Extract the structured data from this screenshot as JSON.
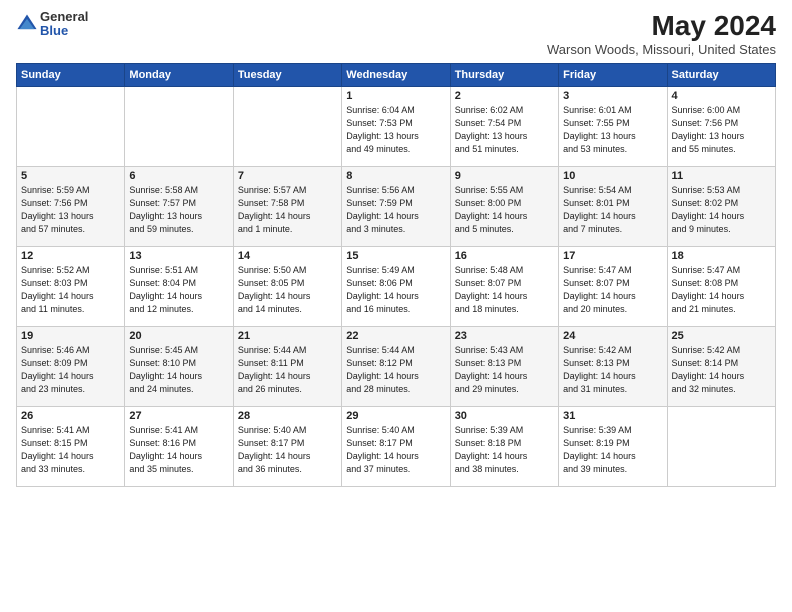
{
  "logo": {
    "general": "General",
    "blue": "Blue"
  },
  "title": "May 2024",
  "subtitle": "Warson Woods, Missouri, United States",
  "headers": [
    "Sunday",
    "Monday",
    "Tuesday",
    "Wednesday",
    "Thursday",
    "Friday",
    "Saturday"
  ],
  "weeks": [
    [
      {
        "day": "",
        "info": ""
      },
      {
        "day": "",
        "info": ""
      },
      {
        "day": "",
        "info": ""
      },
      {
        "day": "1",
        "info": "Sunrise: 6:04 AM\nSunset: 7:53 PM\nDaylight: 13 hours\nand 49 minutes."
      },
      {
        "day": "2",
        "info": "Sunrise: 6:02 AM\nSunset: 7:54 PM\nDaylight: 13 hours\nand 51 minutes."
      },
      {
        "day": "3",
        "info": "Sunrise: 6:01 AM\nSunset: 7:55 PM\nDaylight: 13 hours\nand 53 minutes."
      },
      {
        "day": "4",
        "info": "Sunrise: 6:00 AM\nSunset: 7:56 PM\nDaylight: 13 hours\nand 55 minutes."
      }
    ],
    [
      {
        "day": "5",
        "info": "Sunrise: 5:59 AM\nSunset: 7:56 PM\nDaylight: 13 hours\nand 57 minutes."
      },
      {
        "day": "6",
        "info": "Sunrise: 5:58 AM\nSunset: 7:57 PM\nDaylight: 13 hours\nand 59 minutes."
      },
      {
        "day": "7",
        "info": "Sunrise: 5:57 AM\nSunset: 7:58 PM\nDaylight: 14 hours\nand 1 minute."
      },
      {
        "day": "8",
        "info": "Sunrise: 5:56 AM\nSunset: 7:59 PM\nDaylight: 14 hours\nand 3 minutes."
      },
      {
        "day": "9",
        "info": "Sunrise: 5:55 AM\nSunset: 8:00 PM\nDaylight: 14 hours\nand 5 minutes."
      },
      {
        "day": "10",
        "info": "Sunrise: 5:54 AM\nSunset: 8:01 PM\nDaylight: 14 hours\nand 7 minutes."
      },
      {
        "day": "11",
        "info": "Sunrise: 5:53 AM\nSunset: 8:02 PM\nDaylight: 14 hours\nand 9 minutes."
      }
    ],
    [
      {
        "day": "12",
        "info": "Sunrise: 5:52 AM\nSunset: 8:03 PM\nDaylight: 14 hours\nand 11 minutes."
      },
      {
        "day": "13",
        "info": "Sunrise: 5:51 AM\nSunset: 8:04 PM\nDaylight: 14 hours\nand 12 minutes."
      },
      {
        "day": "14",
        "info": "Sunrise: 5:50 AM\nSunset: 8:05 PM\nDaylight: 14 hours\nand 14 minutes."
      },
      {
        "day": "15",
        "info": "Sunrise: 5:49 AM\nSunset: 8:06 PM\nDaylight: 14 hours\nand 16 minutes."
      },
      {
        "day": "16",
        "info": "Sunrise: 5:48 AM\nSunset: 8:07 PM\nDaylight: 14 hours\nand 18 minutes."
      },
      {
        "day": "17",
        "info": "Sunrise: 5:47 AM\nSunset: 8:07 PM\nDaylight: 14 hours\nand 20 minutes."
      },
      {
        "day": "18",
        "info": "Sunrise: 5:47 AM\nSunset: 8:08 PM\nDaylight: 14 hours\nand 21 minutes."
      }
    ],
    [
      {
        "day": "19",
        "info": "Sunrise: 5:46 AM\nSunset: 8:09 PM\nDaylight: 14 hours\nand 23 minutes."
      },
      {
        "day": "20",
        "info": "Sunrise: 5:45 AM\nSunset: 8:10 PM\nDaylight: 14 hours\nand 24 minutes."
      },
      {
        "day": "21",
        "info": "Sunrise: 5:44 AM\nSunset: 8:11 PM\nDaylight: 14 hours\nand 26 minutes."
      },
      {
        "day": "22",
        "info": "Sunrise: 5:44 AM\nSunset: 8:12 PM\nDaylight: 14 hours\nand 28 minutes."
      },
      {
        "day": "23",
        "info": "Sunrise: 5:43 AM\nSunset: 8:13 PM\nDaylight: 14 hours\nand 29 minutes."
      },
      {
        "day": "24",
        "info": "Sunrise: 5:42 AM\nSunset: 8:13 PM\nDaylight: 14 hours\nand 31 minutes."
      },
      {
        "day": "25",
        "info": "Sunrise: 5:42 AM\nSunset: 8:14 PM\nDaylight: 14 hours\nand 32 minutes."
      }
    ],
    [
      {
        "day": "26",
        "info": "Sunrise: 5:41 AM\nSunset: 8:15 PM\nDaylight: 14 hours\nand 33 minutes."
      },
      {
        "day": "27",
        "info": "Sunrise: 5:41 AM\nSunset: 8:16 PM\nDaylight: 14 hours\nand 35 minutes."
      },
      {
        "day": "28",
        "info": "Sunrise: 5:40 AM\nSunset: 8:17 PM\nDaylight: 14 hours\nand 36 minutes."
      },
      {
        "day": "29",
        "info": "Sunrise: 5:40 AM\nSunset: 8:17 PM\nDaylight: 14 hours\nand 37 minutes."
      },
      {
        "day": "30",
        "info": "Sunrise: 5:39 AM\nSunset: 8:18 PM\nDaylight: 14 hours\nand 38 minutes."
      },
      {
        "day": "31",
        "info": "Sunrise: 5:39 AM\nSunset: 8:19 PM\nDaylight: 14 hours\nand 39 minutes."
      },
      {
        "day": "",
        "info": ""
      }
    ]
  ]
}
